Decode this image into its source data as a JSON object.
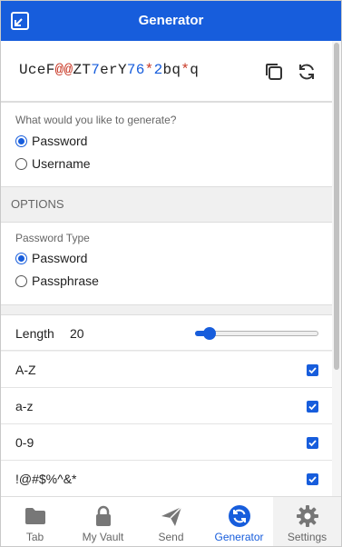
{
  "header": {
    "title": "Generator"
  },
  "password": {
    "parts": [
      {
        "t": "UceF",
        "k": "c"
      },
      {
        "t": "@@",
        "k": "s"
      },
      {
        "t": "ZT",
        "k": "c"
      },
      {
        "t": "7",
        "k": "n"
      },
      {
        "t": "erY",
        "k": "c"
      },
      {
        "t": "76",
        "k": "n"
      },
      {
        "t": "*",
        "k": "s"
      },
      {
        "t": "2",
        "k": "n"
      },
      {
        "t": "bq",
        "k": "c"
      },
      {
        "t": "*",
        "k": "s"
      },
      {
        "t": "q",
        "k": "c"
      }
    ]
  },
  "generate": {
    "label": "What would you like to generate?",
    "options": [
      "Password",
      "Username"
    ],
    "selected": "Password"
  },
  "options_header": "OPTIONS",
  "password_type": {
    "label": "Password Type",
    "options": [
      "Password",
      "Passphrase"
    ],
    "selected": "Password"
  },
  "length": {
    "label": "Length",
    "value": "20",
    "fraction": 0.12
  },
  "charsets": [
    {
      "label": "A-Z",
      "checked": true
    },
    {
      "label": "a-z",
      "checked": true
    },
    {
      "label": "0-9",
      "checked": true
    },
    {
      "label": "!@#$%^&*",
      "checked": true
    }
  ],
  "nav": {
    "items": [
      {
        "label": "Tab",
        "icon": "folder-icon"
      },
      {
        "label": "My Vault",
        "icon": "lock-icon"
      },
      {
        "label": "Send",
        "icon": "paper-plane-icon"
      },
      {
        "label": "Generator",
        "icon": "refresh-icon"
      },
      {
        "label": "Settings",
        "icon": "gear-icon"
      }
    ],
    "active": "Generator"
  },
  "colors": {
    "accent": "#175ddc",
    "special_char": "#c83522",
    "number_char": "#175ddc"
  }
}
